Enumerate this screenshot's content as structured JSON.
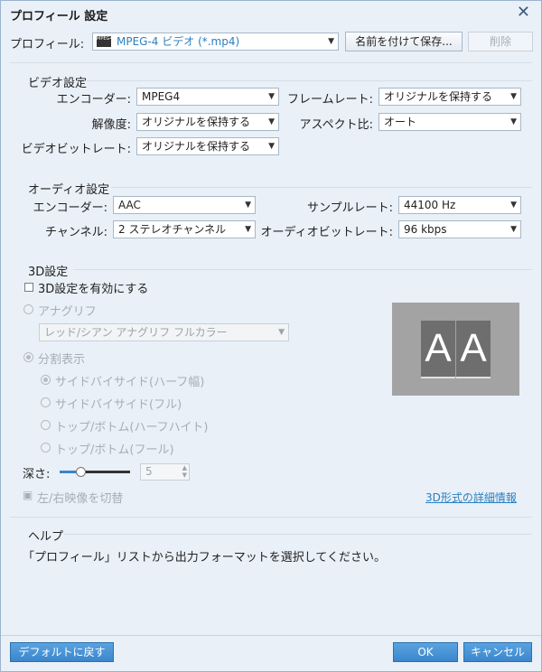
{
  "window": {
    "title": "プロフィール 設定"
  },
  "profile": {
    "label": "プロフィール:",
    "value": "MPEG-4 ビデオ (*.mp4)",
    "icon_text": "MPEG4",
    "save_as": "名前を付けて保存...",
    "delete": "削除"
  },
  "video": {
    "title": "ビデオ設定",
    "encoder_label": "エンコーダー:",
    "encoder": "MPEG4",
    "framerate_label": "フレームレート:",
    "framerate": "オリジナルを保持する",
    "resolution_label": "解像度:",
    "resolution": "オリジナルを保持する",
    "aspect_label": "アスペクト比:",
    "aspect": "オート",
    "bitrate_label": "ビデオビットレート:",
    "bitrate": "オリジナルを保持する"
  },
  "audio": {
    "title": "オーディオ設定",
    "encoder_label": "エンコーダー:",
    "encoder": "AAC",
    "samplerate_label": "サンプルレート:",
    "samplerate": "44100 Hz",
    "channel_label": "チャンネル:",
    "channel": "2 ステレオチャンネル",
    "bitrate_label": "オーディオビットレート:",
    "bitrate": "96 kbps"
  },
  "threed": {
    "title": "3D設定",
    "enable": "3D設定を有効にする",
    "enabled": false,
    "anaglyph": "アナグリフ",
    "anaglyph_mode": "レッド/シアン アナグリフ フルカラー",
    "split": "分割表示",
    "options": [
      "サイドバイサイド(ハーフ幅)",
      "サイドバイサイド(フル)",
      "トップ/ボトム(ハーフハイト)",
      "トップ/ボトム(フール)"
    ],
    "selected_option": 0,
    "depth_label": "深さ:",
    "depth_value": "5",
    "depth_fraction": 0.3,
    "swap": "左/右映像を切替",
    "details_link": "3D形式の詳細情報",
    "preview_text": "AA"
  },
  "help": {
    "title": "ヘルプ",
    "text": "「プロフィール」リストから出力フォーマットを選択してください。"
  },
  "footer": {
    "default": "デフォルトに戻す",
    "ok": "OK",
    "cancel": "キャンセル"
  }
}
